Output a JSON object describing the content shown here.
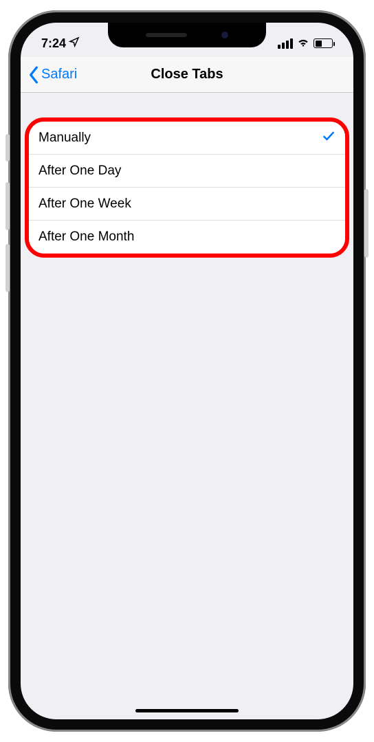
{
  "status": {
    "time": "7:24",
    "location_icon": "location-arrow"
  },
  "nav": {
    "back_label": "Safari",
    "title": "Close Tabs"
  },
  "options": [
    {
      "label": "Manually",
      "selected": true
    },
    {
      "label": "After One Day",
      "selected": false
    },
    {
      "label": "After One Week",
      "selected": false
    },
    {
      "label": "After One Month",
      "selected": false
    }
  ]
}
